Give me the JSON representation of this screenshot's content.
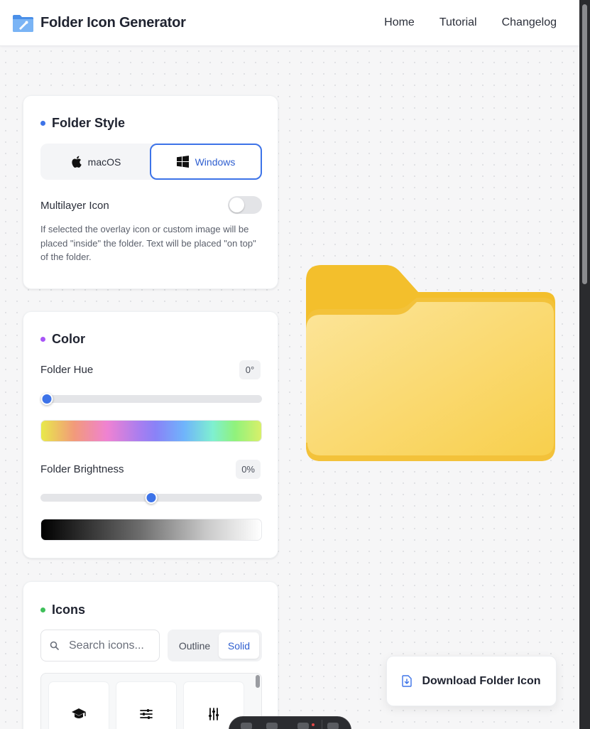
{
  "header": {
    "title": "Folder Icon Generator",
    "logo_icon": "folder-paint-icon",
    "nav": [
      "Home",
      "Tutorial",
      "Changelog"
    ]
  },
  "folder_style": {
    "title": "Folder Style",
    "dot_color": "#3d73e8",
    "options": [
      {
        "label": "macOS",
        "icon": "apple-icon",
        "selected": false
      },
      {
        "label": "Windows",
        "icon": "windows-icon",
        "selected": true
      }
    ],
    "multilayer_label": "Multilayer Icon",
    "multilayer_enabled": false,
    "help_text": "If selected the overlay icon or custom image will be placed \"inside\" the folder. Text will be placed \"on top\" of the folder."
  },
  "color": {
    "title": "Color",
    "dot_color": "#a855f7",
    "hue": {
      "label": "Folder Hue",
      "value_text": "0°",
      "slider_fraction": 0.03
    },
    "brightness": {
      "label": "Folder Brightness",
      "value_text": "0%",
      "slider_fraction": 0.5
    }
  },
  "icons": {
    "title": "Icons",
    "dot_color": "#3fbf5a",
    "search_placeholder": "Search icons...",
    "variants": [
      {
        "label": "Outline",
        "selected": false
      },
      {
        "label": "Solid",
        "selected": true
      }
    ],
    "tiles": [
      "graduation-cap-icon",
      "sliders-horizontal-icon",
      "sliders-vertical-icon"
    ]
  },
  "preview": {
    "folder_back_color": "#f3bf2c",
    "folder_front_color": "#fbe08a"
  },
  "download": {
    "label": "Download Folder Icon",
    "icon": "download-file-icon"
  }
}
